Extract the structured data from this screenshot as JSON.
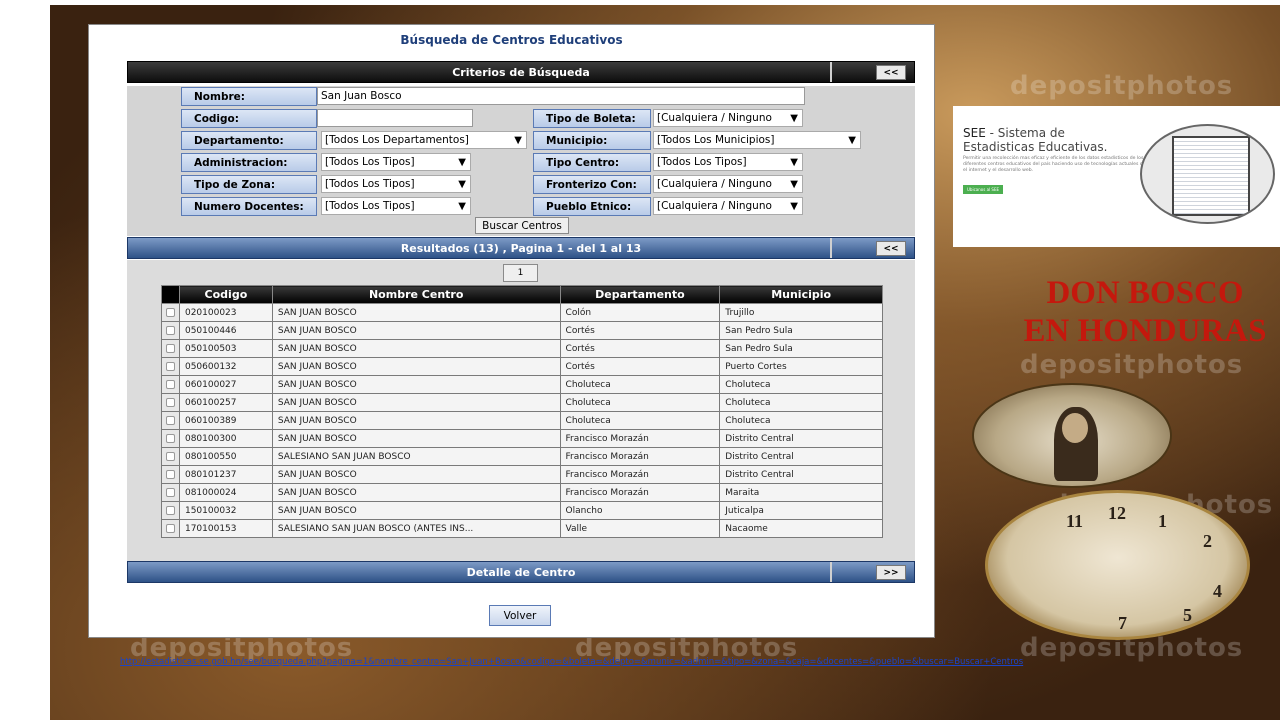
{
  "page": {
    "title": "Búsqueda de Centros Educativos",
    "url": "http://estadisticas.se.gob.hn/see/busqueda.php?pagina=1&nombre_centro=San+Juan+Bosco&codigo=&boleta=&depto=&munic=&admin=&tipo=&zona=&caja=&docentes=&pueblo=&buscar=Buscar+Centros"
  },
  "criteria": {
    "header": "Criterios de Búsqueda",
    "toggle_label": "<<",
    "fields": {
      "nombre": {
        "label": "Nombre:",
        "value": "San Juan Bosco"
      },
      "codigo": {
        "label": "Codigo:",
        "value": ""
      },
      "tipo_boleta": {
        "label": "Tipo de Boleta:",
        "value": "[Cualquiera / Ninguno"
      },
      "departamento": {
        "label": "Departamento:",
        "value": "[Todos Los Departamentos]"
      },
      "municipio": {
        "label": "Municipio:",
        "value": "[Todos Los Municipios]"
      },
      "administracion": {
        "label": "Administracion:",
        "value": "[Todos Los Tipos]"
      },
      "tipo_centro": {
        "label": "Tipo Centro:",
        "value": "[Todos Los Tipos]"
      },
      "tipo_zona": {
        "label": "Tipo de Zona:",
        "value": "[Todos Los Tipos]"
      },
      "fronterizo": {
        "label": "Fronterizo Con:",
        "value": "[Cualquiera / Ninguno"
      },
      "numero_docentes": {
        "label": "Numero Docentes:",
        "value": "[Todos Los Tipos]"
      },
      "pueblo_etnico": {
        "label": "Pueblo Etnico:",
        "value": "[Cualquiera / Ninguno"
      }
    },
    "search_button": "Buscar Centros",
    "dropdown_arrow": "▼"
  },
  "results": {
    "header": "Resultados (13) , Pagina 1 - del 1 al 13",
    "toggle_label": "<<",
    "page_button": "1",
    "columns": [
      "Codigo",
      "Nombre Centro",
      "Departamento",
      "Municipio"
    ],
    "rows": [
      [
        "020100023",
        "SAN JUAN BOSCO",
        "Colón",
        "Trujillo"
      ],
      [
        "050100446",
        "SAN JUAN BOSCO",
        "Cortés",
        "San Pedro Sula"
      ],
      [
        "050100503",
        "SAN JUAN BOSCO",
        "Cortés",
        "San Pedro Sula"
      ],
      [
        "050600132",
        "SAN JUAN BOSCO",
        "Cortés",
        "Puerto Cortes"
      ],
      [
        "060100027",
        "SAN JUAN BOSCO",
        "Choluteca",
        "Choluteca"
      ],
      [
        "060100257",
        "SAN JUAN BOSCO",
        "Choluteca",
        "Choluteca"
      ],
      [
        "060100389",
        "SAN JUAN BOSCO",
        "Choluteca",
        "Choluteca"
      ],
      [
        "080100300",
        "SAN JUAN BOSCO",
        "Francisco Morazán",
        "Distrito Central"
      ],
      [
        "080100550",
        "SALESIANO SAN JUAN BOSCO",
        "Francisco Morazán",
        "Distrito Central"
      ],
      [
        "080101237",
        "SAN JUAN BOSCO",
        "Francisco Morazán",
        "Distrito Central"
      ],
      [
        "081000024",
        "SAN JUAN BOSCO",
        "Francisco Morazán",
        "Maraita"
      ],
      [
        "150100032",
        "SAN JUAN BOSCO",
        "Olancho",
        "Juticalpa"
      ],
      [
        "170100153",
        "SALESIANO SAN JUAN BOSCO (ANTES INS...",
        "Valle",
        "Nacaome"
      ]
    ]
  },
  "detail": {
    "header": "Detalle de Centro",
    "toggle_label": ">>"
  },
  "back_button": "Volver",
  "see_card": {
    "title_abbr": "SEE",
    "title_rest": " - Sistema de Estadisticas Educativas.",
    "description": "Permitir una recolección mas eficaz y eficiente de los datos estadísticos de los diferentes centros educativos del país haciendo uso de tecnologías actuales como el internet y el desarrollo web.",
    "button": "Ubicanos al SEE"
  },
  "headline": {
    "line1": "DON BOSCO",
    "line2": "EN HONDURAS"
  },
  "watermark_text": "depositphotos",
  "clock_numbers": [
    "11",
    "12",
    "1",
    "2",
    "4",
    "5",
    "7"
  ],
  "colors": {
    "headline": "#c4180d",
    "section_bar": "#2e5287",
    "link": "#1a44c8"
  }
}
